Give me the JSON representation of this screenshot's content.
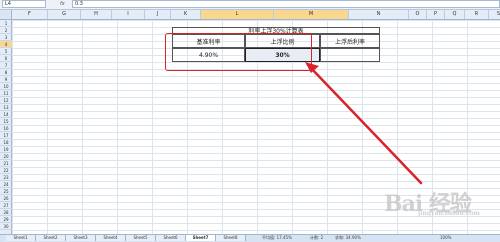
{
  "formula_bar": {
    "name_box": "L4",
    "fx": "fx",
    "value": "0.3"
  },
  "columns": [
    {
      "id": "F",
      "w": 36
    },
    {
      "id": "G",
      "w": 33
    },
    {
      "id": "H",
      "w": 31
    },
    {
      "id": "I",
      "w": 33
    },
    {
      "id": "J",
      "w": 26
    },
    {
      "id": "K",
      "w": 30
    },
    {
      "id": "L",
      "w": 73,
      "sel": true
    },
    {
      "id": "M",
      "w": 75,
      "sel": true
    },
    {
      "id": "N",
      "w": 60
    },
    {
      "id": "O",
      "w": 18
    },
    {
      "id": "P",
      "w": 18
    },
    {
      "id": "Q",
      "w": 20
    },
    {
      "id": "R",
      "w": 24
    },
    {
      "id": "S",
      "w": 20
    }
  ],
  "rows": [
    "1",
    "2",
    "3",
    "4",
    "5",
    "6",
    "7",
    "8",
    "9",
    "10",
    "11",
    "12",
    "13",
    "14",
    "15",
    "16",
    "17",
    "18",
    "19",
    "20",
    "21",
    "22",
    "23",
    "24",
    "25",
    "26",
    "27",
    "28",
    "29",
    "30"
  ],
  "selected_row": "4",
  "table": {
    "title": "利率上浮30%计算表",
    "h1": "基准利率",
    "h2": "上浮比例",
    "h3": "上浮后利率",
    "v1": "4.90%",
    "v2": "30%",
    "v3": ""
  },
  "sheets": [
    "Sheet1",
    "Sheet2",
    "Sheet3",
    "Sheet4",
    "Sheet5",
    "Sheet6",
    "Sheet7",
    "Sheet8"
  ],
  "active_sheet": "Sheet7",
  "status": {
    "avg": "平均值: 17.45%",
    "count": "计数: 2",
    "sum": "求和: 34.90%",
    "zoom": "100%"
  },
  "watermark": {
    "main": "Bai 经验",
    "sub": "jingyan.baidu.com"
  },
  "colors": {
    "accent_red": "#d9232a",
    "header_sel": "#f9d78e"
  }
}
